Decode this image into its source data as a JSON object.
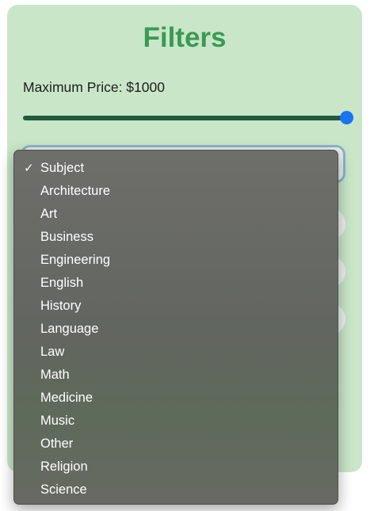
{
  "filters": {
    "title": "Filters",
    "price_label": "Maximum Price: $1000",
    "price_slider": {
      "value": 1000,
      "max": 1000,
      "fraction": 1.0
    }
  },
  "subject_menu": {
    "selected": "Subject",
    "check_glyph": "✓",
    "options": [
      "Subject",
      "Architecture",
      "Art",
      "Business",
      "Engineering",
      "English",
      "History",
      "Language",
      "Law",
      "Math",
      "Medicine",
      "Music",
      "Other",
      "Religion",
      "Science"
    ]
  },
  "colors": {
    "panel_bg": "#c9e6c9",
    "title": "#3a9a54",
    "slider_fill": "#1f5b3c",
    "slider_thumb": "#1a73f0",
    "menu_bg": "#65675f"
  }
}
